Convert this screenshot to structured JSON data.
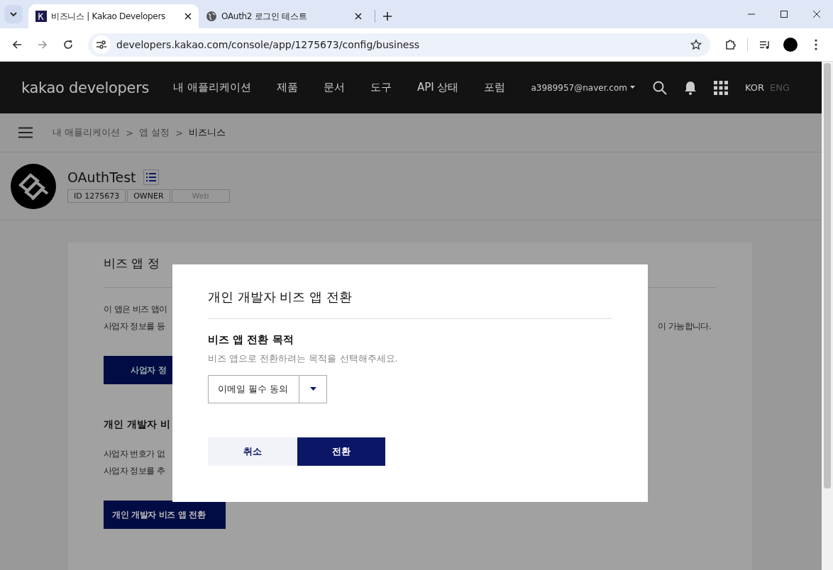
{
  "browser": {
    "tabs": [
      {
        "title": "비즈니스 | Kakao Developers",
        "selected": true,
        "kind": "site"
      },
      {
        "title": "OAuth2 로그인 테스트",
        "selected": false,
        "kind": "globe"
      }
    ],
    "url": "developers.kakao.com/console/app/1275673/config/business"
  },
  "header": {
    "logo": "kakao developers",
    "nav": [
      "내 애플리케이션",
      "제품",
      "문서",
      "도구",
      "API 상태",
      "포럼"
    ],
    "account": "a3989957@naver.com",
    "languages": [
      {
        "label": "KOR",
        "selected": true
      },
      {
        "label": "ENG",
        "selected": false
      }
    ]
  },
  "breadcrumb": {
    "items": [
      "내 애플리케이션",
      "앱 설정",
      "비즈니스"
    ],
    "separator": ">"
  },
  "app": {
    "name": "OAuthTest",
    "tags": [
      {
        "label": "ID 1275673",
        "active": true
      },
      {
        "label": "OWNER",
        "active": true
      },
      {
        "label": "Web",
        "active": false
      }
    ]
  },
  "card": {
    "title": "비즈 앱 정",
    "lines": [
      {
        "left": "이 앱은 비즈 앱이"
      },
      {
        "left": "사업자 정보를 등",
        "right": "이 가능합니다."
      }
    ],
    "button": "사업자 정",
    "section_title": "개인 개발자 비",
    "section_lines": [
      "사업자 번호가 없",
      "사업자 정보를 추"
    ],
    "section_button": "개인 개발자 비즈 앱 전환"
  },
  "modal": {
    "title": "개인 개발자 비즈 앱 전환",
    "field_label": "비즈 앱 전환 목적",
    "help": "비즈 앱으로 전환하려는 목적을 선택해주세요.",
    "select_value": "이메일 필수 동의",
    "buttons": [
      {
        "label": "취소",
        "kind": "secondary"
      },
      {
        "label": "전환",
        "kind": "primary"
      }
    ]
  }
}
